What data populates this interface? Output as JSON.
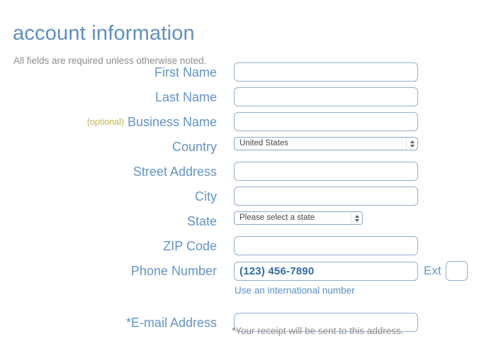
{
  "header": {
    "title": "account information",
    "subtitle": "All fields are required unless otherwise noted."
  },
  "form": {
    "optional_tag": "(optional)",
    "fields": [
      {
        "key": "first_name",
        "label": "First Name",
        "type": "text",
        "value": "",
        "placeholder": ""
      },
      {
        "key": "last_name",
        "label": "Last Name",
        "type": "text",
        "value": "",
        "placeholder": ""
      },
      {
        "key": "business_name",
        "label": "Business Name",
        "type": "text",
        "value": "",
        "placeholder": "",
        "optional": true
      },
      {
        "key": "country",
        "label": "Country",
        "type": "select",
        "value": "United States"
      },
      {
        "key": "street_address",
        "label": "Street Address",
        "type": "text",
        "value": "",
        "placeholder": ""
      },
      {
        "key": "city",
        "label": "City",
        "type": "text",
        "value": "",
        "placeholder": ""
      },
      {
        "key": "state",
        "label": "State",
        "type": "select",
        "value": "Please select a state"
      },
      {
        "key": "zip_code",
        "label": "ZIP Code",
        "type": "text",
        "value": "",
        "placeholder": ""
      },
      {
        "key": "phone_number",
        "label": "Phone Number",
        "type": "tel",
        "value": "(123) 456-7890"
      },
      {
        "key": "email_address",
        "label": "*E-mail Address",
        "type": "text",
        "value": "",
        "placeholder": ""
      }
    ],
    "ext_label": "Ext",
    "ext_value": "",
    "international_link": "Use an international number",
    "receipt_note": "*Your receipt will be sent to this address."
  },
  "colors": {
    "label_blue": "#6394c9",
    "title_blue": "#5e8ec4",
    "optional_gold": "#c2b257",
    "muted_gray": "#8e8e8e",
    "input_border": "#93afce",
    "phone_text": "#2f6ba8"
  }
}
